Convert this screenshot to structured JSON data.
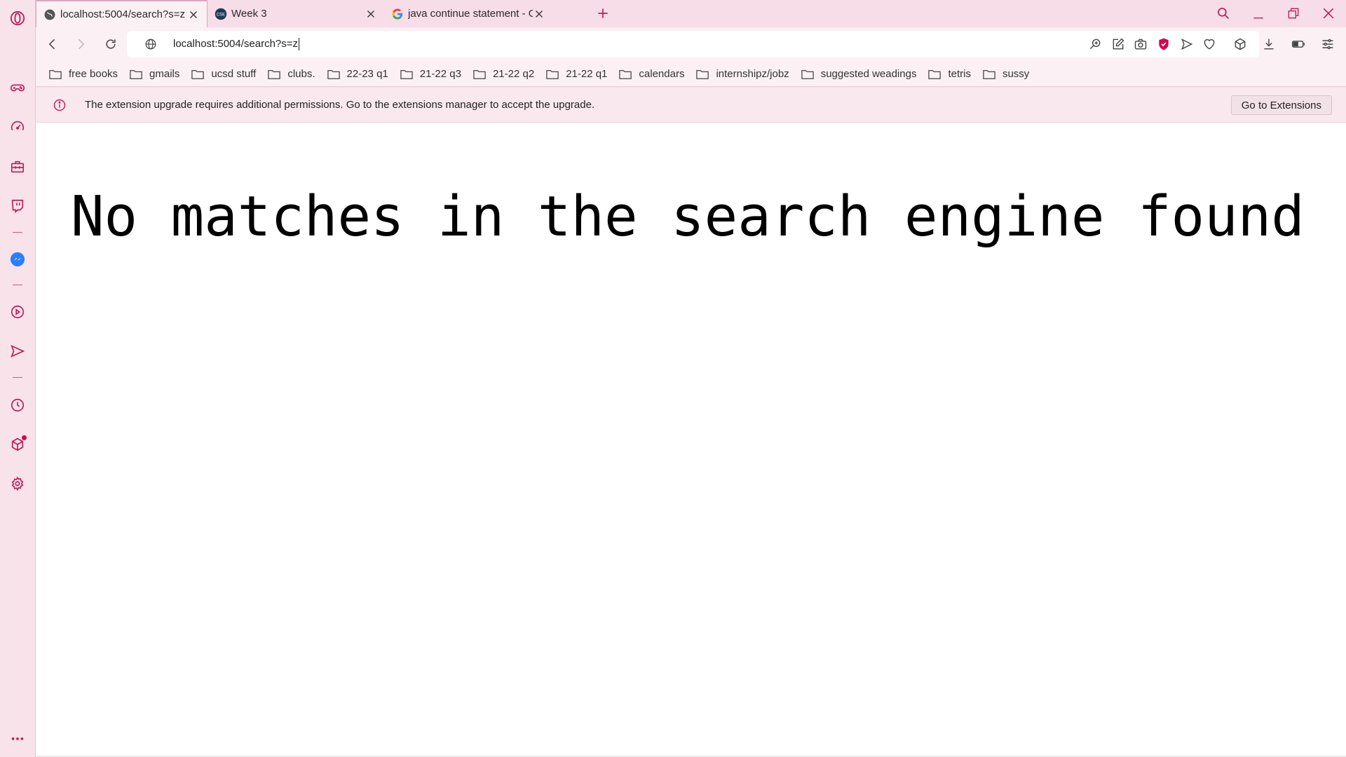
{
  "browser": {
    "accent_color": "#c2185b",
    "tabs": [
      {
        "title": "localhost:5004/search?s=z",
        "favicon": "globe-icon",
        "active": true
      },
      {
        "title": "Week 3",
        "favicon": "cse-ucsd-icon",
        "active": false
      },
      {
        "title": "java continue statement - G",
        "favicon": "google-icon",
        "active": false
      }
    ],
    "address": "localhost:5004/search?s=z"
  },
  "bookmarks": [
    "free books",
    "gmails",
    "ucsd stuff",
    "clubs.",
    "22-23 q1",
    "21-22 q3",
    "21-22 q2",
    "21-22 q1",
    "calendars",
    "internshipz/jobz",
    "suggested weadings",
    "tetris",
    "sussy"
  ],
  "infobar": {
    "message": "The extension upgrade requires additional permissions. Go to the extensions manager to accept the upgrade.",
    "button_label": "Go to Extensions"
  },
  "page": {
    "heading": "No matches in the search engine found"
  }
}
